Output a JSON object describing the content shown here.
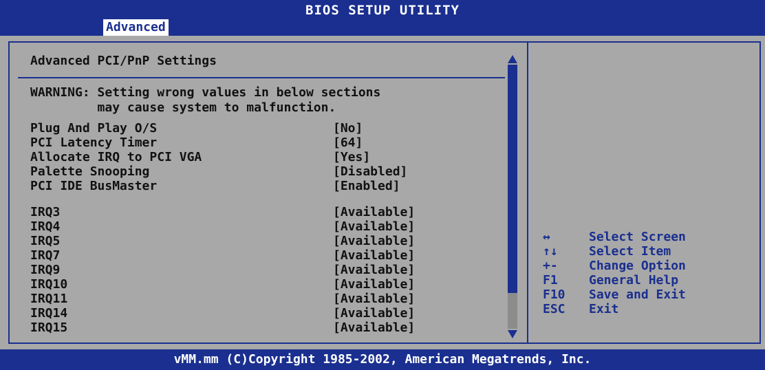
{
  "app": {
    "title": "BIOS SETUP UTILITY",
    "active_tab": "Advanced"
  },
  "main": {
    "heading": "Advanced PCI/PnP Settings",
    "warning_line1": "WARNING: Setting wrong values in below sections",
    "warning_line2": "         may cause system to malfunction.",
    "settings": [
      {
        "label": "Plug And Play O/S",
        "value": "[No]"
      },
      {
        "label": "PCI Latency Timer",
        "value": "[64]"
      },
      {
        "label": "Allocate IRQ to PCI VGA",
        "value": "[Yes]"
      },
      {
        "label": "Palette Snooping",
        "value": "[Disabled]"
      },
      {
        "label": "PCI IDE BusMaster",
        "value": "[Enabled]"
      }
    ],
    "irqs": [
      {
        "label": "IRQ3",
        "value": "[Available]"
      },
      {
        "label": "IRQ4",
        "value": "[Available]"
      },
      {
        "label": "IRQ5",
        "value": "[Available]"
      },
      {
        "label": "IRQ7",
        "value": "[Available]"
      },
      {
        "label": "IRQ9",
        "value": "[Available]"
      },
      {
        "label": "IRQ10",
        "value": "[Available]"
      },
      {
        "label": "IRQ11",
        "value": "[Available]"
      },
      {
        "label": "IRQ14",
        "value": "[Available]"
      },
      {
        "label": "IRQ15",
        "value": "[Available]"
      }
    ]
  },
  "help": [
    {
      "key": "↔",
      "desc": "Select Screen"
    },
    {
      "key": "↑↓",
      "desc": "Select Item"
    },
    {
      "key": "+-",
      "desc": "Change Option"
    },
    {
      "key": "F1",
      "desc": "General Help"
    },
    {
      "key": "F10",
      "desc": "Save and Exit"
    },
    {
      "key": "ESC",
      "desc": "Exit"
    }
  ],
  "footer": "vMM.mm (C)Copyright 1985-2002, American Megatrends, Inc.",
  "colors": {
    "blue": "#1a2f8f",
    "panel": "#a8a8a8",
    "white": "#ffffff"
  }
}
